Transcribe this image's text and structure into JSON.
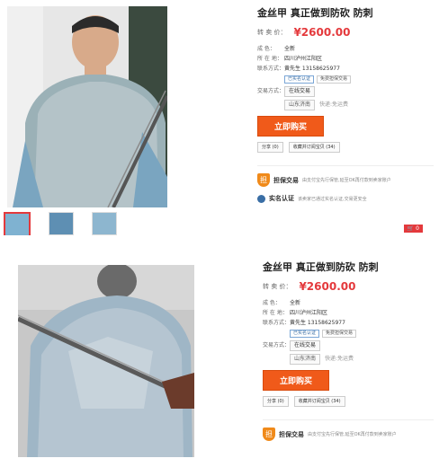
{
  "colors": {
    "accent": "#e4393c",
    "buy": "#f05a1a",
    "shield": "#f08a1a"
  },
  "listing": {
    "title": "金丝甲 真正做到防砍 防刺",
    "price_label": "转 卖 价：",
    "price": "¥2600.00",
    "condition_label": "成    色：",
    "condition": "全新",
    "location_label": "所 在 地：",
    "location": "四川泸州江阳区",
    "contact_label": "联系方式：",
    "contact": "黄先生 13158625977",
    "tag_verified": "已实名认证",
    "tag_free": "免费担保交易",
    "trade_label": "交易方式：",
    "trade": "在线交易",
    "ship_from": "山东济南",
    "ship_note": "快递:免运费",
    "buy_label": "立即购买",
    "share_label": "分享 (0)",
    "fav_label": "收藏并订阅宝贝 (34)",
    "guard_title": "担保交易",
    "guard_desc": "由支付宝先行保管,延至OK再付款到卖家账户",
    "auth_title": "实名认证",
    "auth_desc": "该卖家已通过实名认证,交易更安全",
    "cart_count": "0"
  }
}
